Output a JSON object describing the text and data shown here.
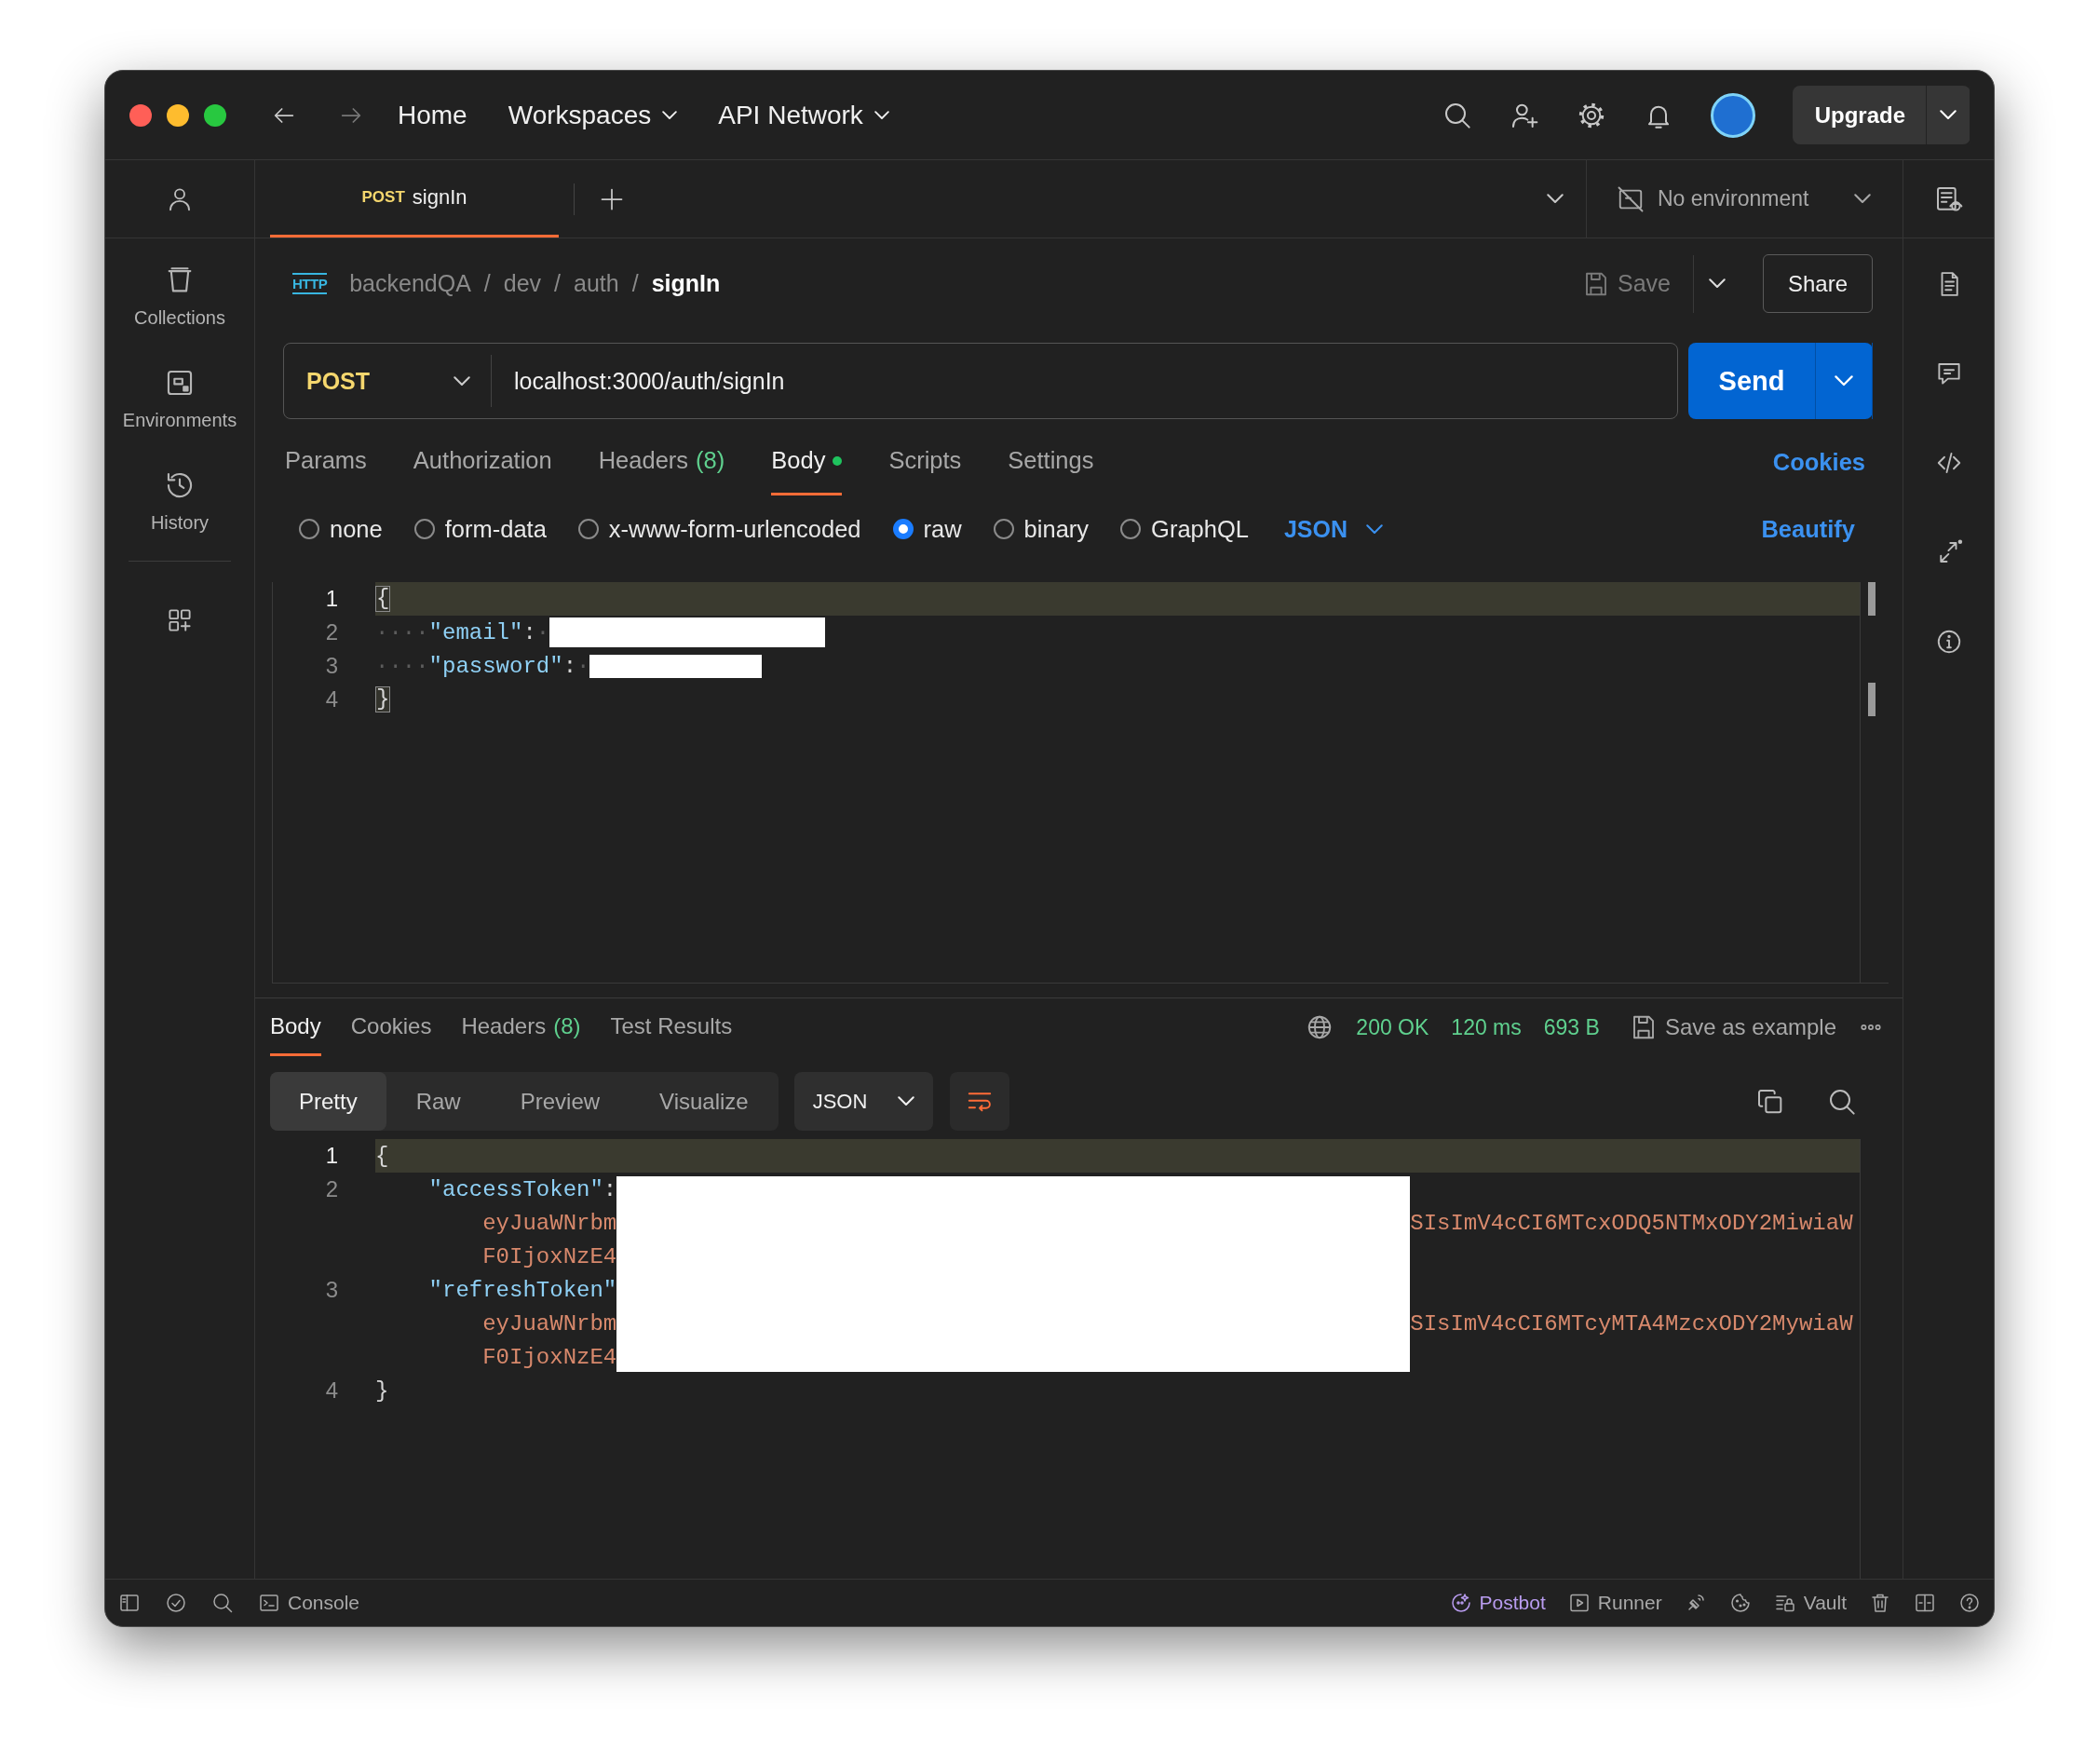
{
  "nav": {
    "items": [
      {
        "label": "Home",
        "dropdown": false
      },
      {
        "label": "Workspaces",
        "dropdown": true
      },
      {
        "label": "API Network",
        "dropdown": true
      }
    ],
    "upgrade": "Upgrade"
  },
  "sidebar": {
    "items": [
      {
        "label": "Collections",
        "kind": "collections"
      },
      {
        "label": "Environments",
        "kind": "environments"
      },
      {
        "label": "History",
        "kind": "history"
      }
    ]
  },
  "tabs": [
    {
      "method": "POST",
      "label": "signIn",
      "selected": true
    }
  ],
  "environment": {
    "label": "No environment"
  },
  "breadcrumb": {
    "icon_text": "HTTP",
    "path": [
      "backendQA",
      "dev",
      "auth"
    ],
    "separator": "/",
    "current": "signIn",
    "save": "Save",
    "share": "Share"
  },
  "request": {
    "method": "POST",
    "url": "localhost:3000/auth/signIn",
    "send": "Send"
  },
  "request_tabs": [
    {
      "label": "Params",
      "selected": false,
      "indicator": false
    },
    {
      "label": "Authorization",
      "selected": false,
      "indicator": false
    },
    {
      "label": "Headers",
      "count": "(8)",
      "selected": false,
      "indicator": false
    },
    {
      "label": "Body",
      "selected": true,
      "indicator": true
    },
    {
      "label": "Scripts",
      "selected": false,
      "indicator": false
    },
    {
      "label": "Settings",
      "selected": false,
      "indicator": false
    }
  ],
  "cookies": "Cookies",
  "body_types": [
    {
      "label": "none",
      "selected": false
    },
    {
      "label": "form-data",
      "selected": false
    },
    {
      "label": "x-www-form-urlencoded",
      "selected": false
    },
    {
      "label": "raw",
      "selected": true
    },
    {
      "label": "binary",
      "selected": false
    },
    {
      "label": "GraphQL",
      "selected": false
    }
  ],
  "body_format": "JSON",
  "beautify": "Beautify",
  "request_body": [
    {
      "number": "1",
      "active": true,
      "segments": [
        {
          "kind": "brace",
          "text": "{"
        }
      ]
    },
    {
      "number": "2",
      "active": false,
      "segments": [
        {
          "kind": "ws",
          "text": "····"
        },
        {
          "kind": "key",
          "text": "\"email\""
        },
        {
          "kind": "punct",
          "text": ":"
        },
        {
          "kind": "ws",
          "text": "·"
        },
        {
          "kind": "redacted"
        }
      ]
    },
    {
      "number": "3",
      "active": false,
      "segments": [
        {
          "kind": "ws",
          "text": "····"
        },
        {
          "kind": "key",
          "text": "\"password\""
        },
        {
          "kind": "punct",
          "text": ":"
        },
        {
          "kind": "ws",
          "text": "·"
        },
        {
          "kind": "redacted"
        }
      ]
    },
    {
      "number": "4",
      "active": false,
      "segments": [
        {
          "kind": "brace",
          "text": "}"
        }
      ]
    }
  ],
  "response_tabs": [
    {
      "label": "Body",
      "selected": true
    },
    {
      "label": "Cookies",
      "selected": false
    },
    {
      "label": "Headers",
      "count": "(8)",
      "selected": false
    },
    {
      "label": "Test Results",
      "selected": false
    }
  ],
  "response_status": {
    "status": "200 OK",
    "time": "120 ms",
    "size": "693 B",
    "save_example": "Save as example"
  },
  "view_modes": [
    {
      "label": "Pretty",
      "selected": true
    },
    {
      "label": "Raw",
      "selected": false
    },
    {
      "label": "Preview",
      "selected": false
    },
    {
      "label": "Visualize",
      "selected": false
    }
  ],
  "response_format": "JSON",
  "response_body": [
    {
      "number": "1",
      "kind": "top",
      "active": true,
      "segments": [
        {
          "kind": "punct",
          "text": "{"
        }
      ]
    },
    {
      "number": "2",
      "kind": "member",
      "active": false,
      "segments": [
        {
          "kind": "key",
          "text": "\"accessToken\""
        },
        {
          "kind": "punct",
          "text": ":"
        },
        {
          "kind": "redacted"
        }
      ]
    },
    {
      "kind": "wrap",
      "active": false,
      "segments": [
        {
          "kind": "string",
          "text": "eyJuaWNrbm"
        },
        {
          "kind": "redacted"
        },
        {
          "kind": "string",
          "text": "SIsImV4cCI6MTcxODQ5NTMxODY2MiwiaW"
        }
      ]
    },
    {
      "kind": "wrap",
      "active": false,
      "segments": [
        {
          "kind": "string",
          "text": "F0IjoxNzE4"
        },
        {
          "kind": "redacted"
        }
      ]
    },
    {
      "number": "3",
      "kind": "member",
      "active": false,
      "segments": [
        {
          "kind": "key",
          "text": "\"refreshToken\""
        },
        {
          "kind": "redacted"
        }
      ]
    },
    {
      "kind": "wrap",
      "active": false,
      "segments": [
        {
          "kind": "string",
          "text": "eyJuaWNrbm"
        },
        {
          "kind": "redacted"
        },
        {
          "kind": "string",
          "text": "SIsImV4cCI6MTcyMTA4MzcxODY2MywiaW"
        }
      ]
    },
    {
      "kind": "wrap",
      "active": false,
      "segments": [
        {
          "kind": "string",
          "text": "F0IjoxNzE4"
        },
        {
          "kind": "redacted"
        }
      ]
    },
    {
      "number": "4",
      "kind": "top",
      "active": false,
      "segments": [
        {
          "kind": "punct",
          "text": "}"
        }
      ]
    }
  ],
  "status_bar": {
    "console": "Console",
    "items": [
      {
        "label": "Postbot",
        "kind": "postbot"
      },
      {
        "label": "Runner",
        "kind": "runner"
      },
      {
        "kind": "capture"
      },
      {
        "kind": "cookies"
      },
      {
        "label": "Vault",
        "kind": "vault"
      },
      {
        "kind": "trash"
      },
      {
        "kind": "layout"
      },
      {
        "kind": "help"
      }
    ]
  }
}
